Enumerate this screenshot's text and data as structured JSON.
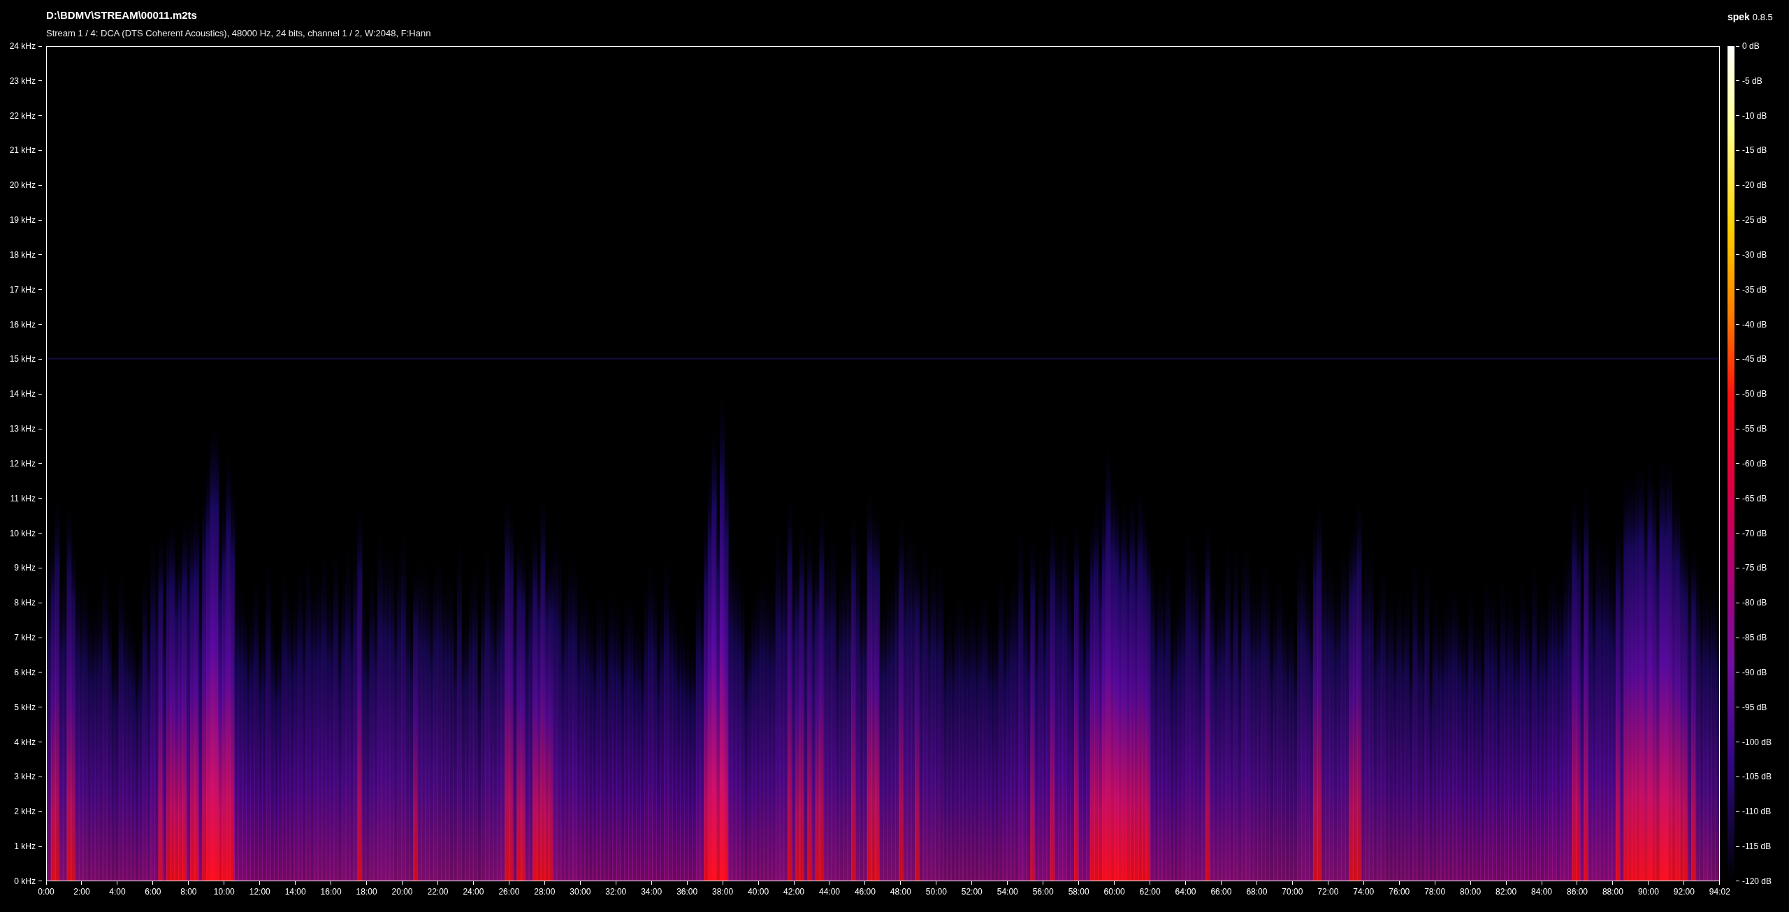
{
  "header": {
    "title": "D:\\BDMV\\STREAM\\00011.m2ts",
    "subtitle": "Stream 1 / 4: DCA (DTS Coherent Acoustics), 48000 Hz, 24 bits, channel 1 / 2, W:2048, F:Hann"
  },
  "app": {
    "name": "spek",
    "version": "0.8.5"
  },
  "frequency_axis": {
    "labels": [
      "24 kHz",
      "23 kHz",
      "22 kHz",
      "21 kHz",
      "20 kHz",
      "19 kHz",
      "18 kHz",
      "17 kHz",
      "16 kHz",
      "15 kHz",
      "14 kHz",
      "13 kHz",
      "12 kHz",
      "11 kHz",
      "10 kHz",
      "9 kHz",
      "8 kHz",
      "7 kHz",
      "6 kHz",
      "5 kHz",
      "4 kHz",
      "3 kHz",
      "2 kHz",
      "1 kHz",
      "0 kHz"
    ]
  },
  "time_axis": {
    "labels": [
      "0:00",
      "2:00",
      "4:00",
      "6:00",
      "8:00",
      "10:00",
      "12:00",
      "14:00",
      "16:00",
      "18:00",
      "20:00",
      "22:00",
      "24:00",
      "26:00",
      "28:00",
      "30:00",
      "32:00",
      "34:00",
      "36:00",
      "38:00",
      "40:00",
      "42:00",
      "44:00",
      "46:00",
      "48:00",
      "50:00",
      "52:00",
      "54:00",
      "56:00",
      "58:00",
      "60:00",
      "62:00",
      "64:00",
      "66:00",
      "68:00",
      "70:00",
      "72:00",
      "74:00",
      "76:00",
      "78:00",
      "80:00",
      "82:00",
      "84:00",
      "86:00",
      "88:00",
      "90:00",
      "92:00",
      "94:02"
    ]
  },
  "db_scale": {
    "labels": [
      "0 dB",
      "-5 dB",
      "-10 dB",
      "-15 dB",
      "-20 dB",
      "-25 dB",
      "-30 dB",
      "-35 dB",
      "-40 dB",
      "-45 dB",
      "-50 dB",
      "-55 dB",
      "-60 dB",
      "-65 dB",
      "-70 dB",
      "-75 dB",
      "-80 dB",
      "-85 dB",
      "-90 dB",
      "-95 dB",
      "-100 dB",
      "-105 dB",
      "-110 dB",
      "-115 dB",
      "-120 dB"
    ]
  }
}
